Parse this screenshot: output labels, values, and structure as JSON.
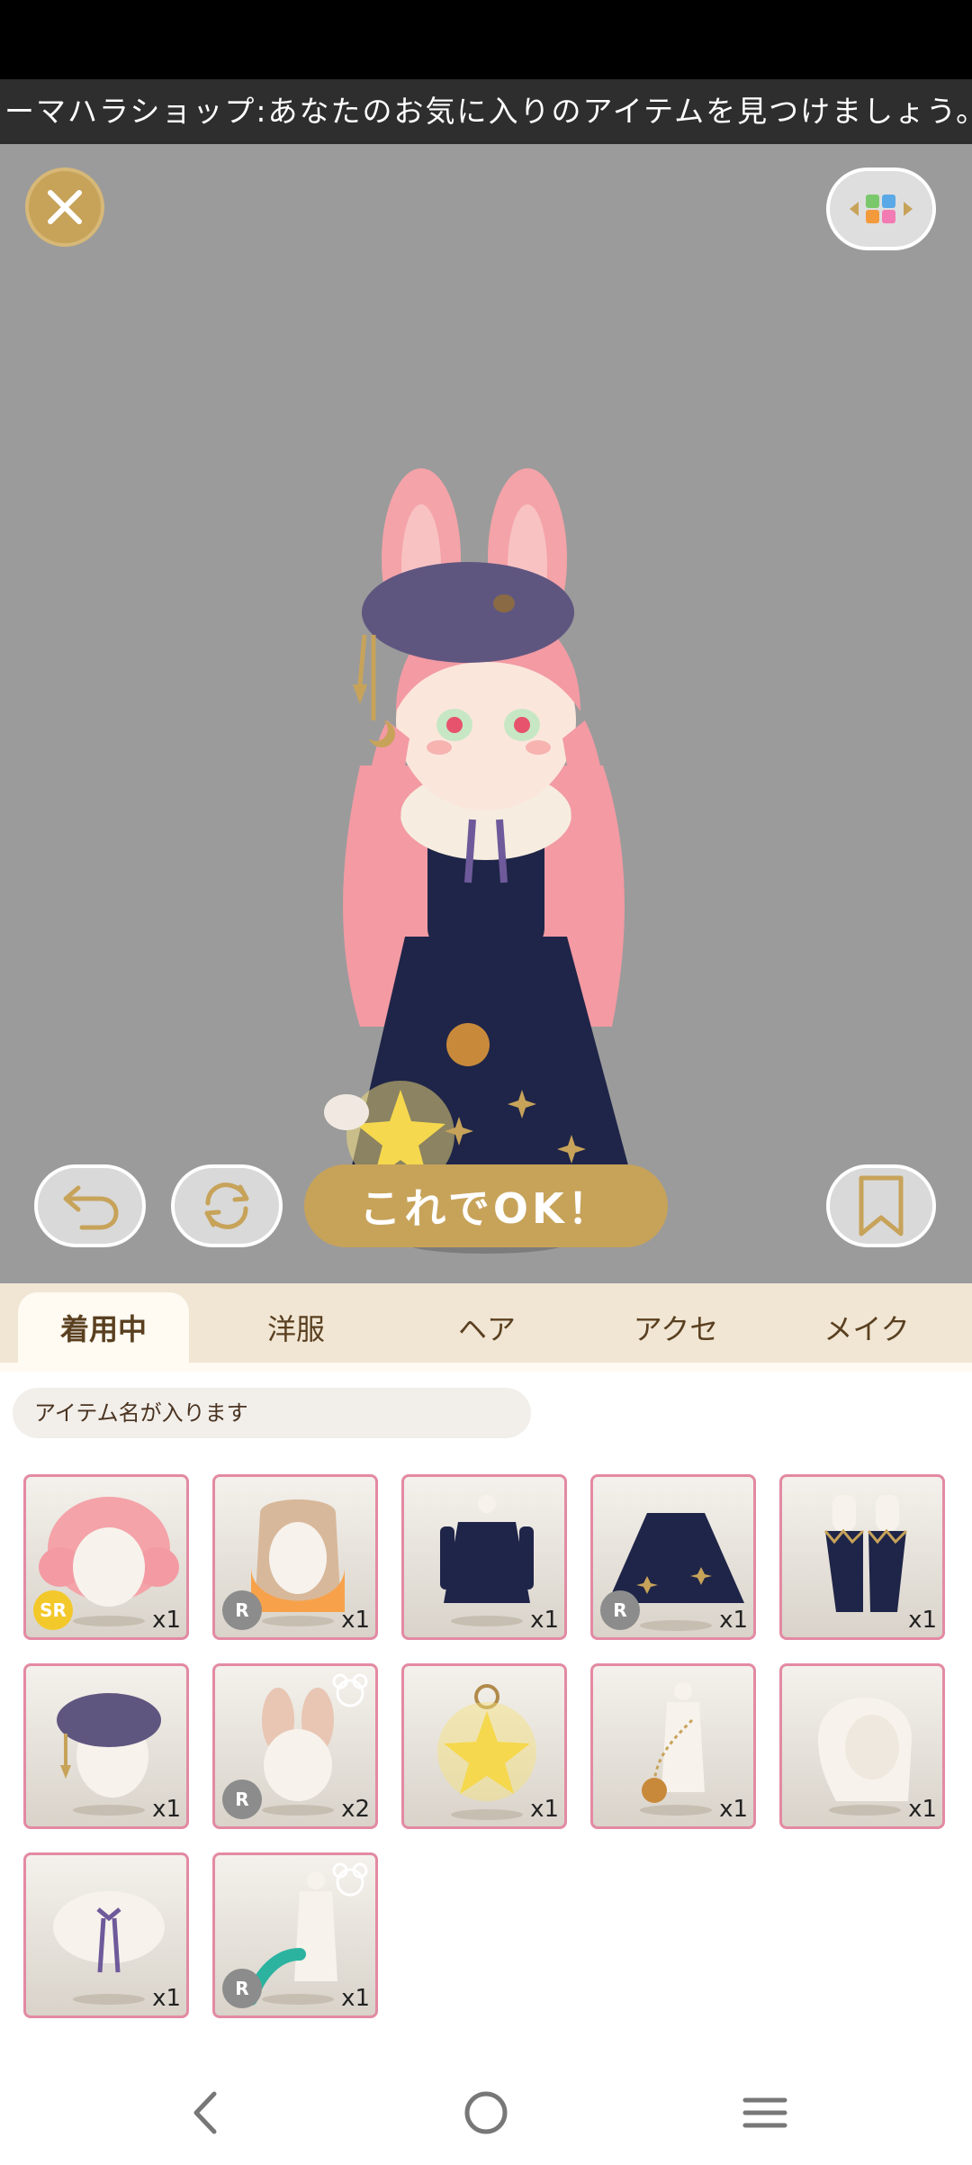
{
  "ticker": {
    "text": "ューマハラショップ:あなたのお気に入りのアイテムを見つけましょう。"
  },
  "controls": {
    "ok_label": "これでOK！"
  },
  "tabs": [
    {
      "label": "着用中",
      "active": true
    },
    {
      "label": "洋服",
      "active": false
    },
    {
      "label": "ヘア",
      "active": false
    },
    {
      "label": "アクセ",
      "active": false
    },
    {
      "label": "メイク",
      "active": false
    }
  ],
  "item_name_placeholder": "アイテム名が入ります",
  "items": [
    {
      "qty": "x1",
      "rarity": "SR"
    },
    {
      "qty": "x1",
      "rarity": "R"
    },
    {
      "qty": "x1",
      "rarity": ""
    },
    {
      "qty": "x1",
      "rarity": "R"
    },
    {
      "qty": "x1",
      "rarity": ""
    },
    {
      "qty": "x1",
      "rarity": ""
    },
    {
      "qty": "x2",
      "rarity": "R"
    },
    {
      "qty": "x1",
      "rarity": ""
    },
    {
      "qty": "x1",
      "rarity": ""
    },
    {
      "qty": "x1",
      "rarity": ""
    },
    {
      "qty": "x1",
      "rarity": ""
    },
    {
      "qty": "x1",
      "rarity": "R"
    }
  ],
  "colors": {
    "accent_gold": "#c7a35a",
    "item_border": "#e38aa3",
    "stage_bg": "#9b9b9b",
    "tab_bg": "#f1e6d4"
  }
}
